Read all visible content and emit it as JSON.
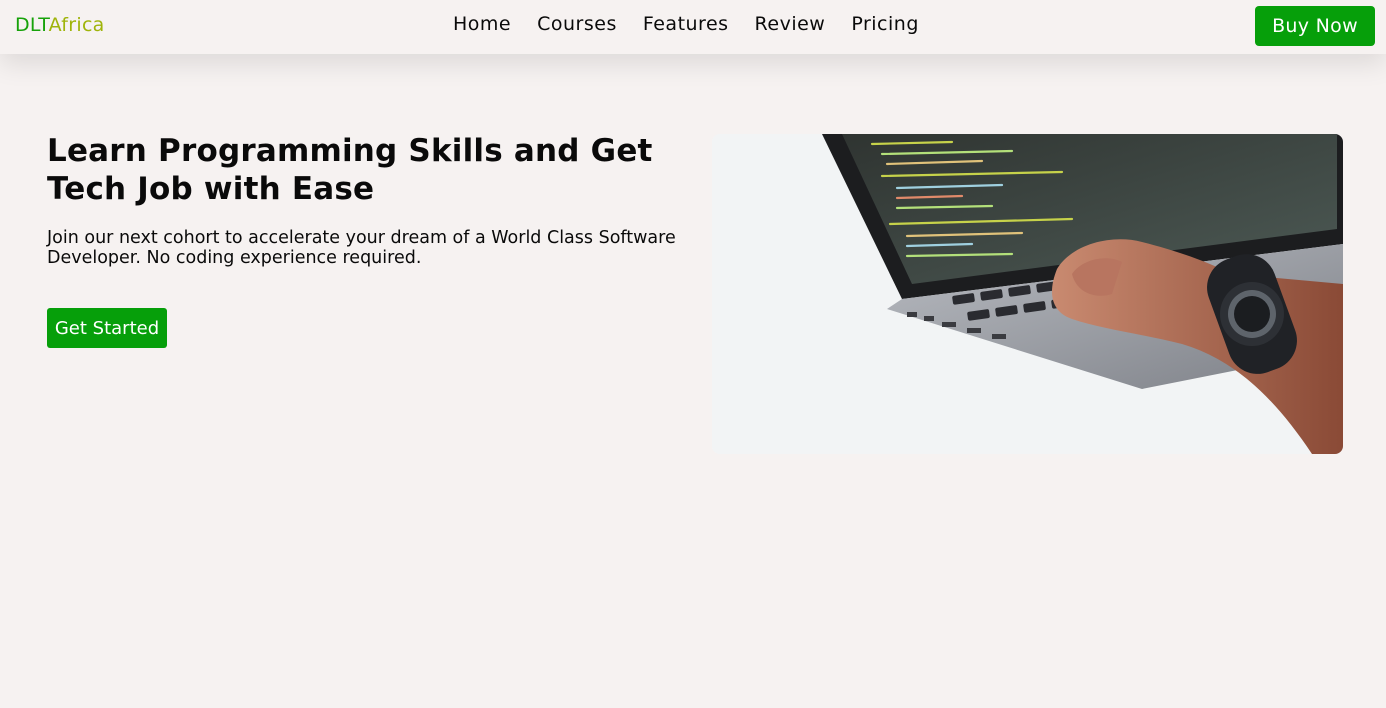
{
  "brand": {
    "part1": "DLT",
    "part2": "Africa"
  },
  "nav": {
    "links": [
      {
        "label": "Home"
      },
      {
        "label": "Courses"
      },
      {
        "label": "Features"
      },
      {
        "label": "Review"
      },
      {
        "label": "Pricing"
      }
    ],
    "buy_label": "Buy Now"
  },
  "hero": {
    "title": "Learn Programming Skills and Get Tech Job with Ease",
    "subtitle": "Join our next cohort to accelerate your dream of a World Class Software Developer. No coding experience required.",
    "cta_label": "Get Started"
  },
  "colors": {
    "background": "#f6f2f1",
    "accent_green": "#069f0a",
    "brand_green": "#17a20a",
    "brand_olive": "#9fb40a"
  }
}
